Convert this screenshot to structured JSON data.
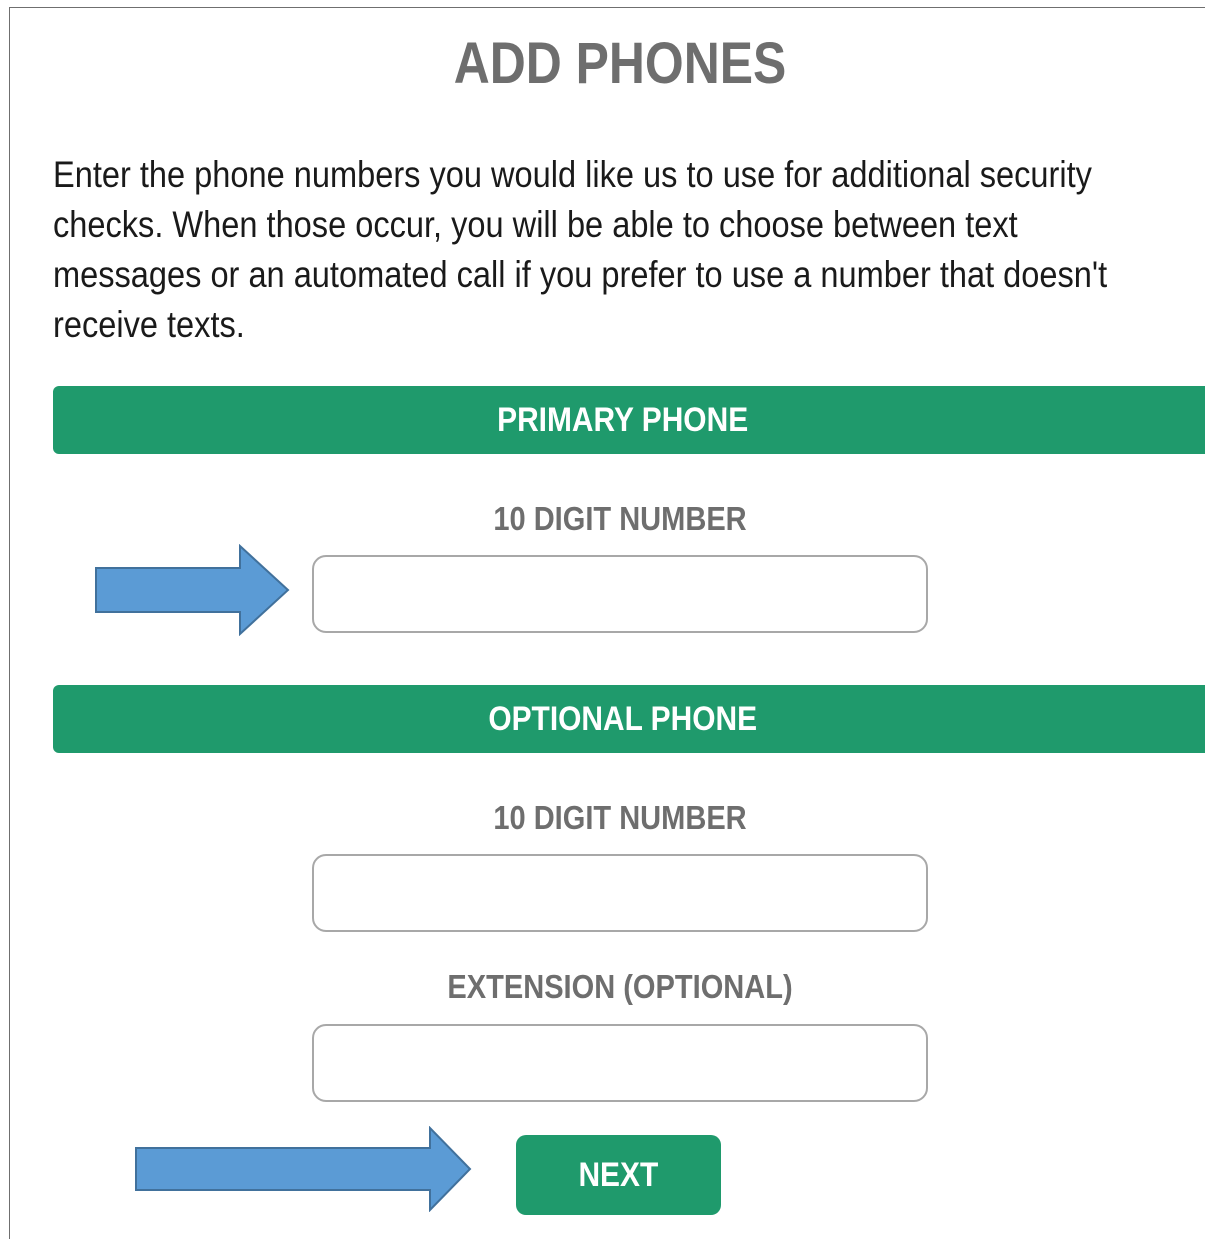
{
  "page": {
    "title": "ADD PHONES",
    "intro": "Enter the phone numbers you would like us to use for additional security checks. When those occur, you will be able to choose between text messages or an automated call if you prefer to use a number that doesn't receive texts."
  },
  "primary": {
    "header": "PRIMARY PHONE",
    "number_label": "10 DIGIT NUMBER",
    "number_value": ""
  },
  "optional": {
    "header": "OPTIONAL PHONE",
    "number_label": "10 DIGIT NUMBER",
    "number_value": "",
    "extension_label": "EXTENSION (OPTIONAL)",
    "extension_value": ""
  },
  "actions": {
    "next_label": "NEXT"
  },
  "annotations": {
    "arrow_color": "#5b9bd5",
    "arrow_outline": "#41719c",
    "arrow_icon": "right-arrow-icon"
  },
  "colors": {
    "accent": "#1f9a6c",
    "title": "#6e6e6e",
    "body_text": "#1a1a1a"
  }
}
